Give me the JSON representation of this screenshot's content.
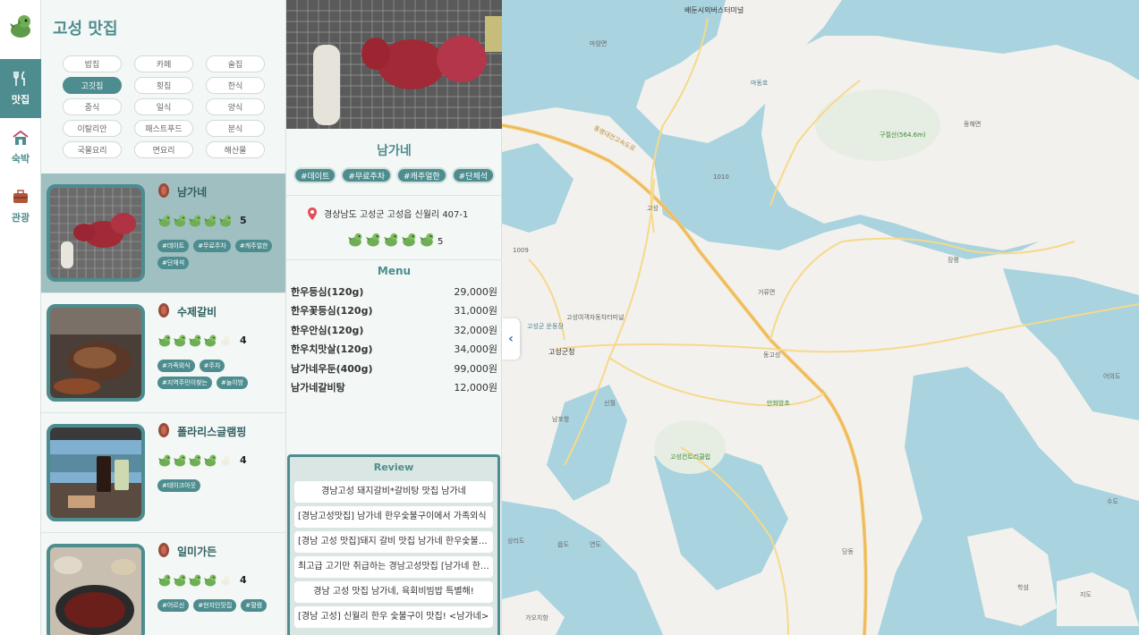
{
  "nav": {
    "items": [
      {
        "label": "맛집",
        "icon": "fork-knife-icon",
        "active": true
      },
      {
        "label": "숙박",
        "icon": "house-icon",
        "active": false
      },
      {
        "label": "관광",
        "icon": "briefcase-icon",
        "active": false
      }
    ]
  },
  "list": {
    "title": "고성 맛집",
    "categories": [
      "밥집",
      "카페",
      "술집",
      "고깃집",
      "횟집",
      "한식",
      "중식",
      "일식",
      "양식",
      "이탈리안",
      "패스트푸드",
      "분식",
      "국물요리",
      "면요리",
      "해산물"
    ],
    "active_category": "고깃집",
    "restaurants": [
      {
        "name": "남가네",
        "rating": "5",
        "stars": 5,
        "tags": [
          "#데이트",
          "#무료주차",
          "#캐주얼한",
          "#단체석"
        ]
      },
      {
        "name": "수제갈비",
        "rating": "4",
        "stars": 4,
        "tags": [
          "#가족외식",
          "#주차",
          "#지역주민이찾는",
          "#놀이방"
        ]
      },
      {
        "name": "폴라리스글램핑",
        "rating": "4",
        "stars": 4,
        "tags": [
          "#테이크아웃"
        ]
      },
      {
        "name": "일미가든",
        "rating": "4",
        "stars": 4,
        "tags": [
          "#어르신",
          "#현지인맛집",
          "#혈렴"
        ]
      }
    ]
  },
  "detail": {
    "name": "남가네",
    "tags": [
      "#데이트",
      "#무료주차",
      "#캐주얼한",
      "#단체석"
    ],
    "address": "경상남도 고성군 고성읍 신월리 407-1",
    "rating": "5",
    "stars": 5,
    "menu_title": "Menu",
    "menu": [
      {
        "item": "한우등심(120g)",
        "price": "29,000원"
      },
      {
        "item": "한우꽃등심(120g)",
        "price": "31,000원"
      },
      {
        "item": "한우안심(120g)",
        "price": "32,000원"
      },
      {
        "item": "한우치맛살(120g)",
        "price": "34,000원"
      },
      {
        "item": "남가네우둔(400g)",
        "price": "99,000원"
      },
      {
        "item": "남가네갈비탕",
        "price": "12,000원"
      }
    ],
    "review_title": "Review",
    "reviews": [
      "경남고성 돼지갈비*갈비탕 맛집 남가네",
      "[경남고성맛집] 남가네 한우숯불구이에서 가족외식",
      "[경남 고성 맛집]돼지 갈비 맛집 남가네 한우숯불구이",
      "최고급 고기만 취급하는 경남고성맛집 [남가네 한우]",
      "경남 고성 맛집 남가네, 육회비빔밥 특별해!",
      "[경남 고성] 신월리 한우 숯불구이 맛집! <남가네>"
    ]
  },
  "map": {
    "labels": [
      "배둔시외버스터미널",
      "마암면",
      "마동호",
      "구절산(564.6m)",
      "동해면",
      "통영대전고속도로",
      "고성",
      "거류면",
      "고성군청",
      "고성여객자동차터미널",
      "고성군 운동장",
      "동고성",
      "만화방초",
      "고성컨트리클럽",
      "신월",
      "남포항",
      "당동",
      "어의도",
      "수도",
      "지도",
      "학섬",
      "장평",
      "상리도",
      "읍도",
      "연도",
      "가오치항",
      "1010",
      "1009"
    ]
  },
  "colors": {
    "accent": "#4e8d8f",
    "sea": "#a9d3df",
    "land": "#f2f1ed",
    "road": "#f4c96b"
  }
}
